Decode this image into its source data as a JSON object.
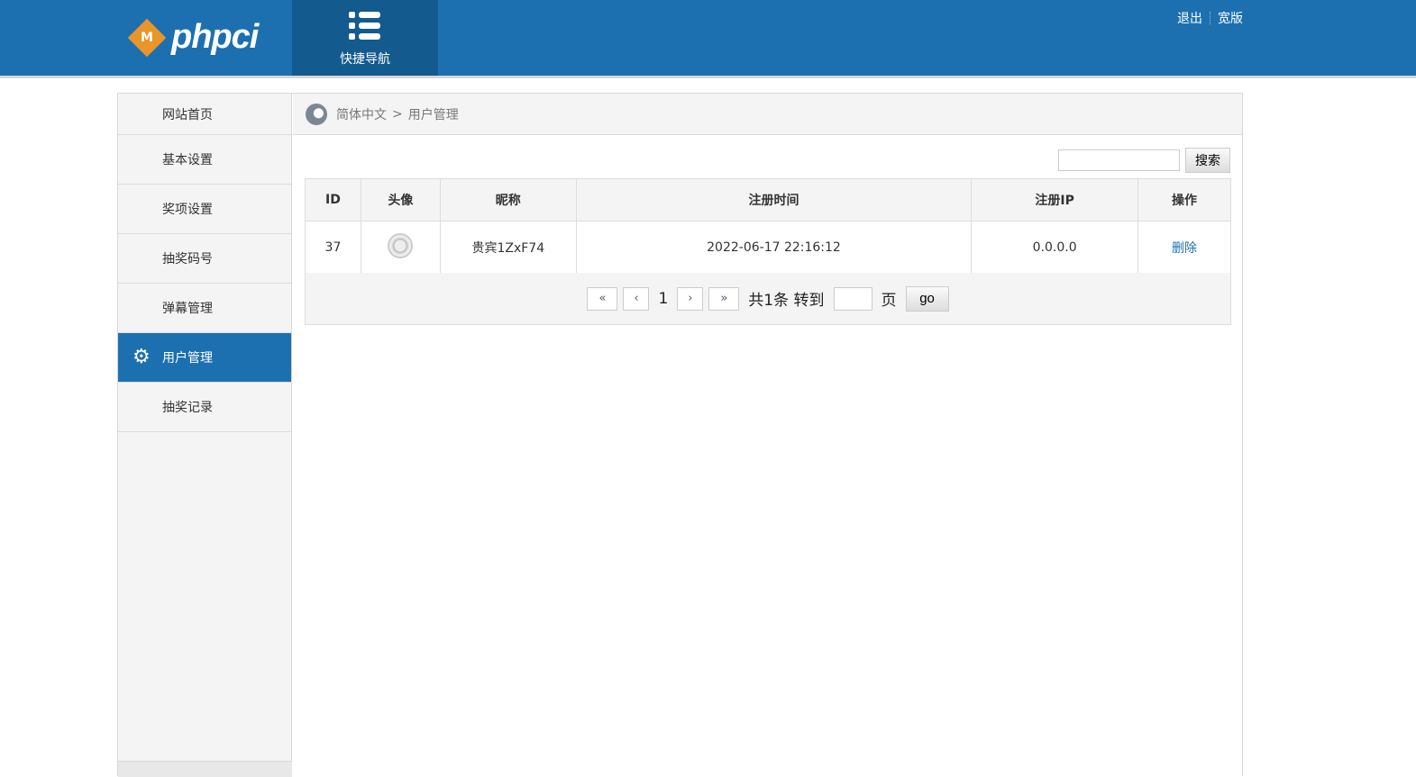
{
  "header": {
    "logo_mark": "M",
    "logo_text": "phpci",
    "quick_nav": "快捷导航",
    "logout": "退出",
    "wide": "宽版"
  },
  "sidebar": {
    "items": [
      {
        "label": "网站首页"
      },
      {
        "label": "基本设置"
      },
      {
        "label": "奖项设置"
      },
      {
        "label": "抽奖码号"
      },
      {
        "label": "弹幕管理"
      },
      {
        "label": "用户管理",
        "active": true
      },
      {
        "label": "抽奖记录"
      }
    ]
  },
  "breadcrumb": {
    "lang": "简体中文",
    "sep": ">",
    "current": "用户管理"
  },
  "search": {
    "value": "",
    "button": "搜索"
  },
  "table": {
    "headers": [
      "ID",
      "头像",
      "昵称",
      "注册时间",
      "注册IP",
      "操作"
    ],
    "rows": [
      {
        "id": "37",
        "nickname": "贵宾1ZxF74",
        "time": "2022-06-17 22:16:12",
        "ip": "0.0.0.0",
        "action": "删除"
      }
    ]
  },
  "pager": {
    "first": "«",
    "prev": "‹",
    "page": "1",
    "next": "›",
    "last": "»",
    "total": "共1条 转到",
    "page_unit": "页",
    "go": "go"
  },
  "colors": {
    "brand": "#1d70b0",
    "nav_dark": "#135a8e",
    "logo": "#e8952a"
  }
}
